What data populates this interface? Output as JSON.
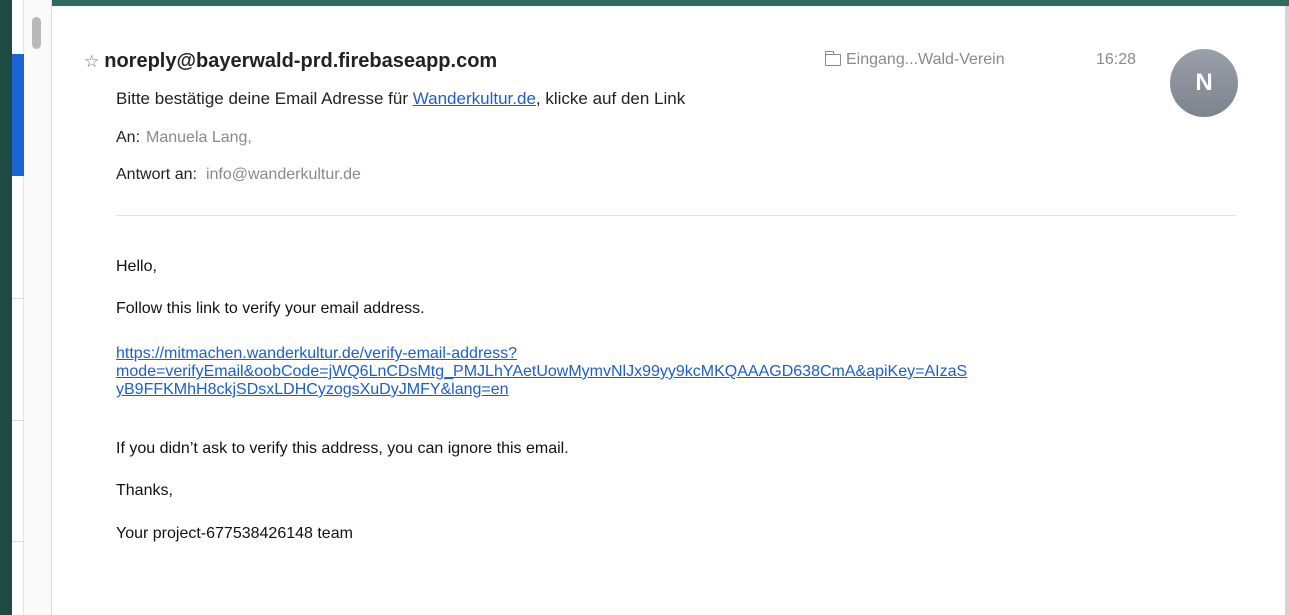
{
  "message": {
    "sender": "noreply@bayerwald-prd.firebaseapp.com",
    "folder": "Eingang...Wald-Verein",
    "time": "16:28",
    "avatar_initial": "N",
    "subject_prefix": "Bitte bestätige deine Email Adresse für ",
    "subject_link": "Wanderkultur.de",
    "subject_suffix": ", klicke auf den Link",
    "to_label": "An:",
    "to_value": "Manuela Lang,",
    "reply_to_label": "Antwort an:",
    "reply_to_value": "info@wanderkultur.de"
  },
  "body": {
    "greeting": "Hello,",
    "instruction": "Follow this link to verify your email address.",
    "link_lines": [
      "https://mitmachen.wanderkultur.de/verify-email-address?",
      "mode=verifyEmail&oobCode=jWQ6LnCDsMtg_PMJLhYAetUowMymvNlJx99yy9kcMKQAAAGD638CmA&apiKey=AIzaS",
      "yB9FFKMhH8ckjSDsxLDHCyzogsXuDyJMFY&lang=en"
    ],
    "ignore_note": "If you didn’t ask to verify this address, you can ignore this email.",
    "thanks": "Thanks,",
    "signature": "Your project-677538426148 team"
  },
  "icons": {
    "star": "star-outline-icon",
    "folder": "folder-icon"
  },
  "colors": {
    "link": "#1a5fd1",
    "accent_sidebar": "#1b64d8",
    "background": "#1d4a42"
  }
}
